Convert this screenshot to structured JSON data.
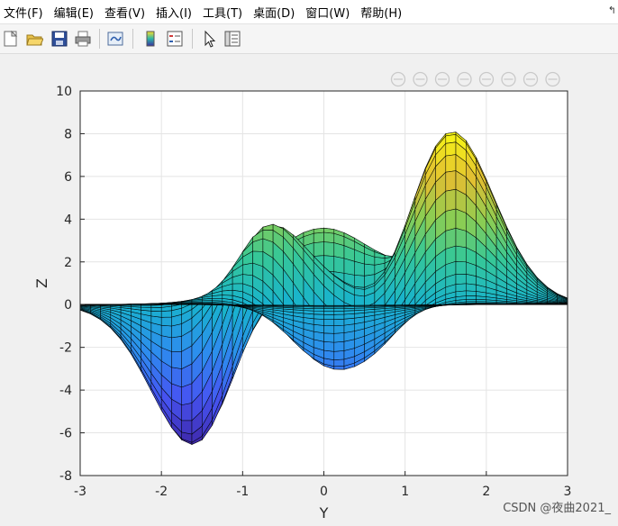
{
  "menu": [
    "文件(F)",
    "编辑(E)",
    "查看(V)",
    "插入(I)",
    "工具(T)",
    "桌面(D)",
    "窗口(W)",
    "帮助(H)"
  ],
  "menu_corner": "↰",
  "toolbar_icons": [
    "new-figure-icon",
    "open-file-icon",
    "save-icon",
    "print-icon",
    "link-plot-icon",
    "insert-colorbar-icon",
    "insert-legend-icon",
    "pointer-icon",
    "property-inspector-icon"
  ],
  "axes_toolbar_icons": [
    "brush-icon",
    "data-tips-icon",
    "export-icon",
    "rotate-3d-icon",
    "pan-icon",
    "zoom-in-icon",
    "zoom-out-icon",
    "home-icon"
  ],
  "watermark": "CSDN @夜曲2021_",
  "chart_data": {
    "type": "surface",
    "function": "peaks",
    "xlabel": "Y",
    "ylabel": "Z",
    "xlim": [
      -3,
      3
    ],
    "ylim": [
      -8,
      10
    ],
    "xticks": [
      "-3",
      "-2",
      "-1",
      "0",
      "1",
      "2",
      "3"
    ],
    "yticks": [
      "10",
      "8",
      "6",
      "4",
      "2",
      "0",
      "-2",
      "-4",
      "-6",
      "-8"
    ],
    "grid": true,
    "colormap": "parula",
    "view": "side (Y-Z plane)",
    "features": [
      {
        "label": "peak",
        "y": 1.6,
        "z": 8.1
      },
      {
        "label": "local max",
        "y": -0.65,
        "z": 3.7
      },
      {
        "label": "local max",
        "y": 0.0,
        "z": 3.6
      },
      {
        "label": "trough",
        "y": -1.6,
        "z": -6.5
      },
      {
        "label": "trough",
        "y": 0.2,
        "z": -3.0
      }
    ]
  }
}
